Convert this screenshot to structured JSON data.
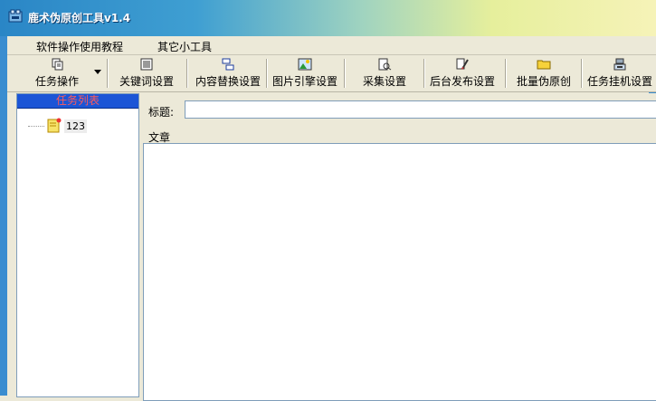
{
  "window": {
    "title": "鹿术伪原创工具v1.4",
    "icon": "app-icon"
  },
  "menu": [
    {
      "label": "软件操作使用教程"
    },
    {
      "label": "其它小工具"
    }
  ],
  "toolbar": [
    {
      "label": "任务操作",
      "icon": "copy-icon",
      "dropdown": true
    },
    {
      "label": "关键词设置",
      "icon": "keyword-icon"
    },
    {
      "label": "内容替换设置",
      "icon": "replace-icon"
    },
    {
      "label": "图片引擎设置",
      "icon": "image-icon"
    },
    {
      "label": "采集设置",
      "icon": "collect-icon"
    },
    {
      "label": "后台发布设置",
      "icon": "publish-icon"
    },
    {
      "label": "批量伪原创",
      "icon": "folder-icon"
    },
    {
      "label": "任务挂机设置",
      "icon": "server-icon"
    }
  ],
  "task_list": {
    "header": "任务列表",
    "items": [
      {
        "label": "123"
      }
    ]
  },
  "editor": {
    "title_label": "标题:",
    "title_value": "",
    "article_label": "文章",
    "article_value": ""
  },
  "colors": {
    "accent": "#1b55d6",
    "header_text": "#ff5a5a",
    "titlebar": "#2a86c6"
  }
}
